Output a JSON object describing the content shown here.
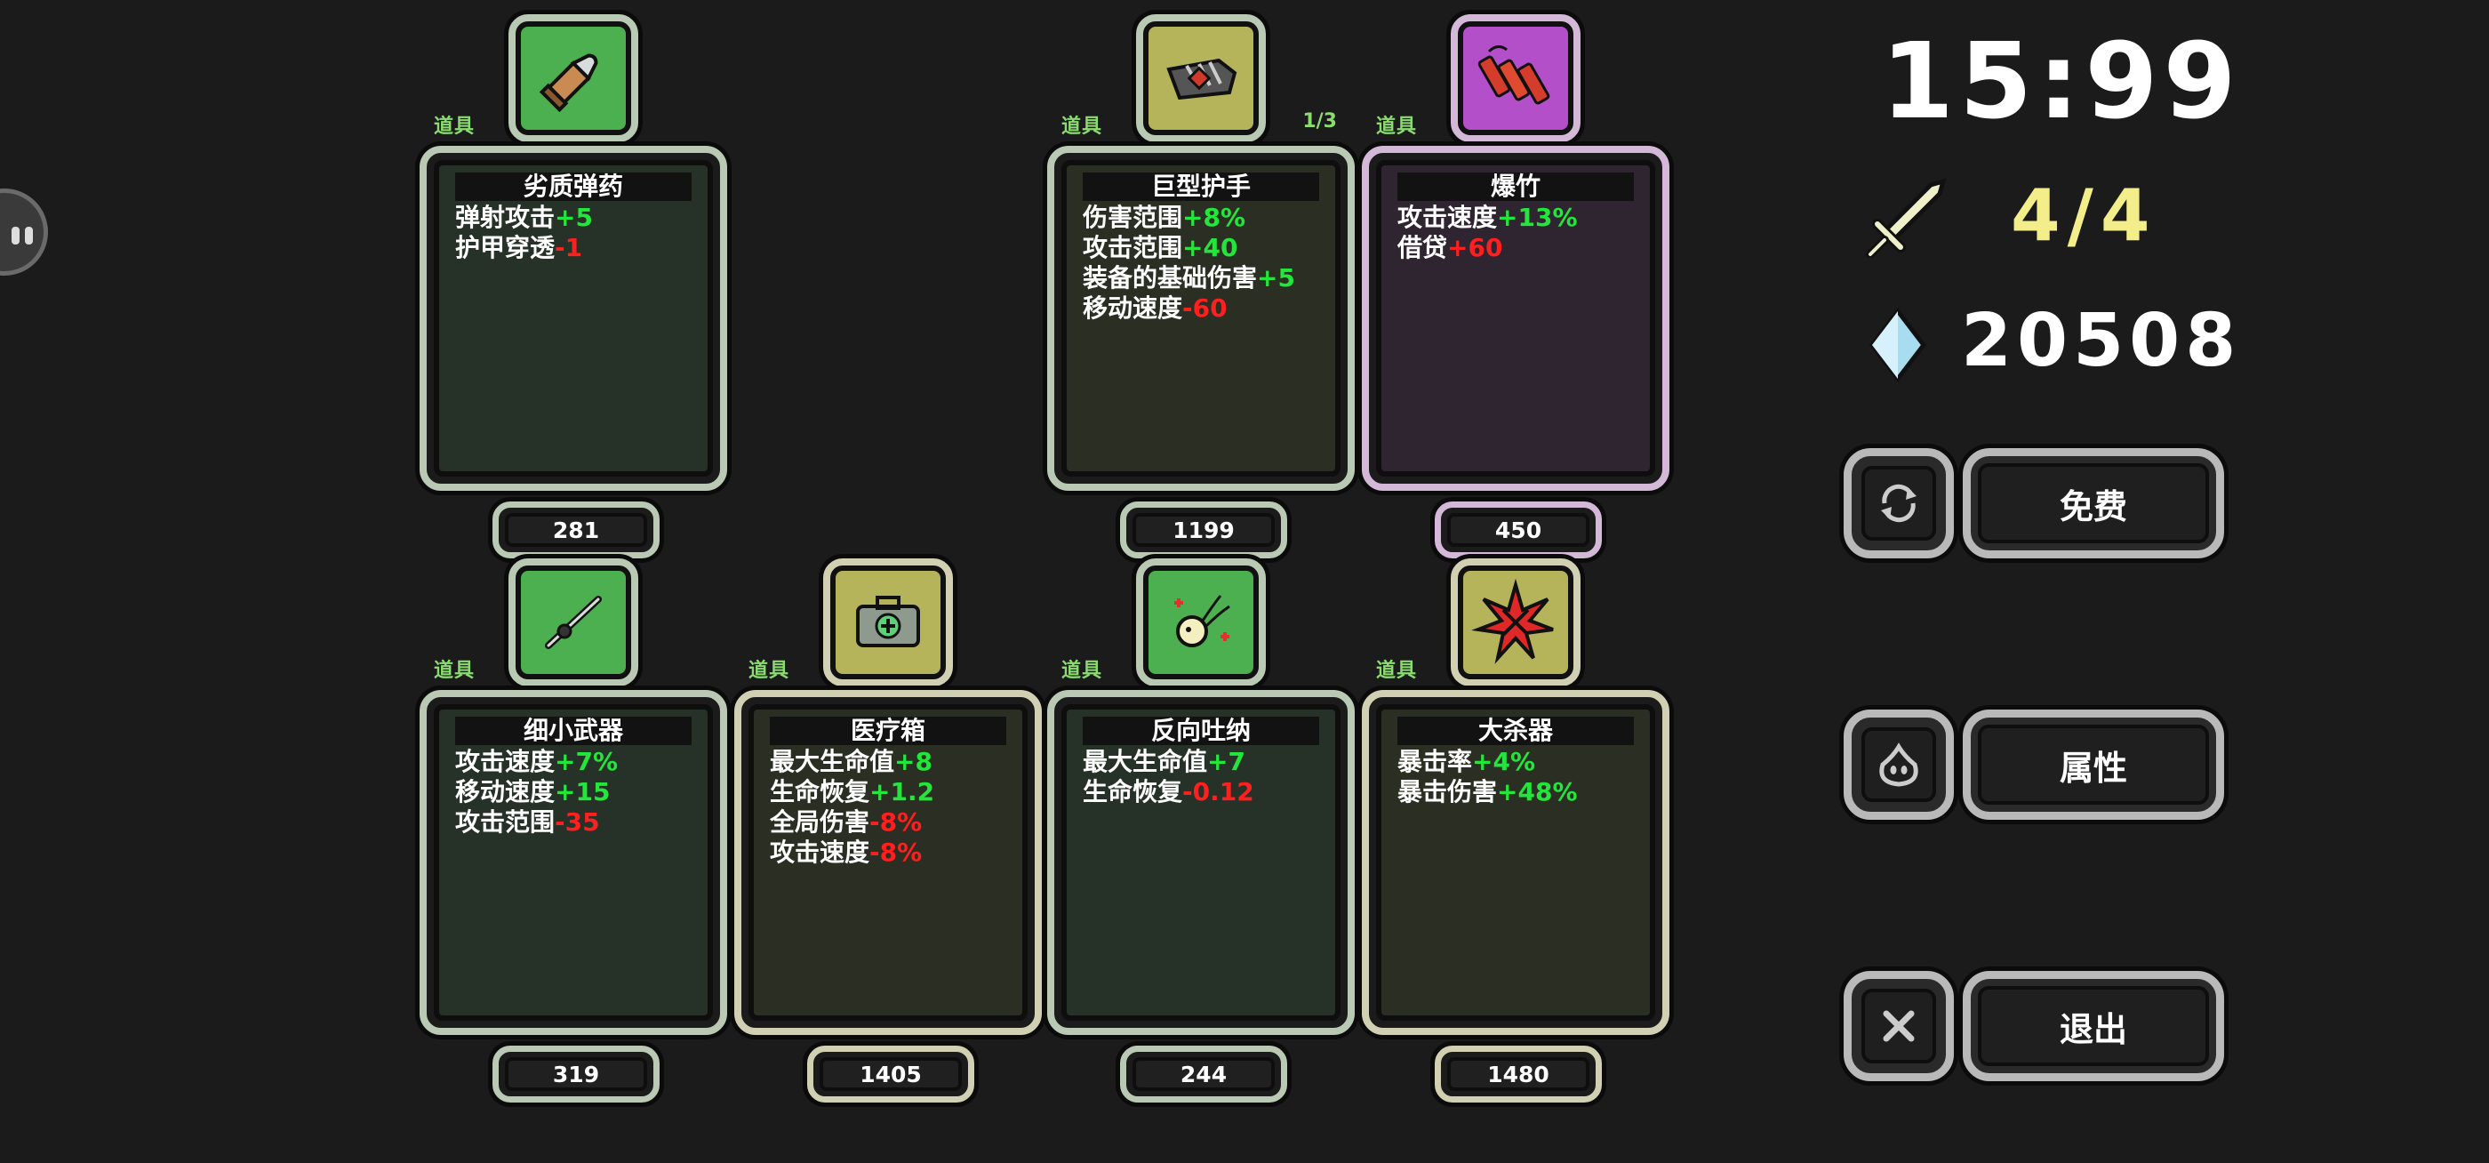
{
  "hud": {
    "timer": "15:99",
    "wave": "4/4",
    "gems": "20508"
  },
  "buttons": {
    "refresh": "免费",
    "attributes": "属性",
    "exit": "退出"
  },
  "colors": {
    "green_tier": "#4caf50",
    "olive_tier": "#b5b45b",
    "purple_tier": "#b24fc9",
    "positive": "#22e63a",
    "negative": "#ff1f1f",
    "tag": "#8bdc6f",
    "wave": "#f3ee8a"
  },
  "items": [
    {
      "tag": "道具",
      "count": "",
      "name": "劣质弹药",
      "price": "281",
      "icon": "bullet-icon",
      "stats": [
        {
          "label": "弹射攻击",
          "value": "+5",
          "sign": "pos"
        },
        {
          "label": "护甲穿透",
          "value": "-1",
          "sign": "neg"
        }
      ]
    },
    {
      "tag": "道具",
      "count": "1/3",
      "name": "巨型护手",
      "price": "1199",
      "icon": "gauntlet-icon",
      "stats": [
        {
          "label": "伤害范围",
          "value": "+8%",
          "sign": "pos"
        },
        {
          "label": "攻击范围",
          "value": "+40",
          "sign": "pos"
        },
        {
          "label": "装备的基础伤害",
          "value": "+5",
          "sign": "pos"
        },
        {
          "label": "移动速度",
          "value": "-60",
          "sign": "neg"
        }
      ]
    },
    {
      "tag": "道具",
      "count": "",
      "name": "爆竹",
      "price": "450",
      "icon": "firecracker-icon",
      "stats": [
        {
          "label": "攻击速度",
          "value": "+13%",
          "sign": "pos"
        },
        {
          "label": "借贷",
          "value": "+60",
          "sign": "neg"
        }
      ]
    },
    {
      "tag": "道具",
      "count": "",
      "name": "细小武器",
      "price": "319",
      "icon": "small-weapon-icon",
      "stats": [
        {
          "label": "攻击速度",
          "value": "+7%",
          "sign": "pos"
        },
        {
          "label": "移动速度",
          "value": "+15",
          "sign": "pos"
        },
        {
          "label": "攻击范围",
          "value": "-35",
          "sign": "neg"
        }
      ]
    },
    {
      "tag": "道具",
      "count": "",
      "name": "医疗箱",
      "price": "1405",
      "icon": "medkit-icon",
      "stats": [
        {
          "label": "最大生命值",
          "value": "+8",
          "sign": "pos"
        },
        {
          "label": "生命恢复",
          "value": "+1.2",
          "sign": "pos"
        },
        {
          "label": "全局伤害",
          "value": "-8%",
          "sign": "neg"
        },
        {
          "label": "攻击速度",
          "value": "-8%",
          "sign": "neg"
        }
      ]
    },
    {
      "tag": "道具",
      "count": "",
      "name": "反向吐纳",
      "price": "244",
      "icon": "reverse-breath-icon",
      "stats": [
        {
          "label": "最大生命值",
          "value": "+7",
          "sign": "pos"
        },
        {
          "label": "生命恢复",
          "value": "-0.12",
          "sign": "neg"
        }
      ]
    },
    {
      "tag": "道具",
      "count": "",
      "name": "大杀器",
      "price": "1480",
      "icon": "explosion-icon",
      "stats": [
        {
          "label": "暴击率",
          "value": "+4%",
          "sign": "pos"
        },
        {
          "label": "暴击伤害",
          "value": "+48%",
          "sign": "pos"
        }
      ]
    }
  ]
}
